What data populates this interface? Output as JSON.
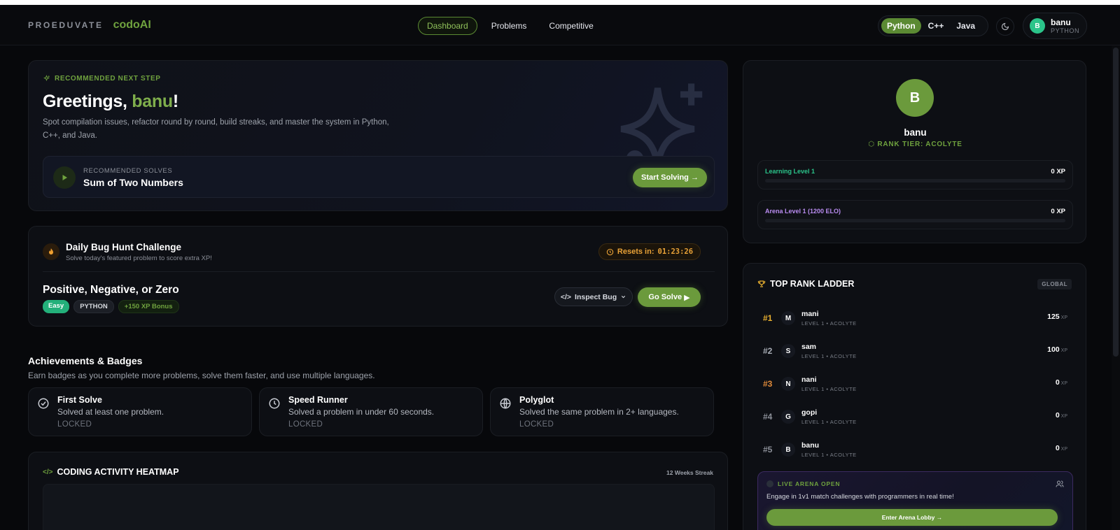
{
  "header": {
    "brand_main": "PROEDUVATE",
    "brand_sub": "codoAI",
    "nav": [
      {
        "label": "Dashboard",
        "active": true
      },
      {
        "label": "Problems",
        "active": false
      },
      {
        "label": "Competitive",
        "active": false
      }
    ],
    "languages": [
      {
        "label": "Python",
        "active": true
      },
      {
        "label": "C++",
        "active": false
      },
      {
        "label": "Java",
        "active": false
      }
    ],
    "theme_icon": "moon-icon",
    "user": {
      "initial": "B",
      "name": "banu",
      "language": "PYTHON"
    }
  },
  "hero": {
    "kicker": "RECOMMENDED NEXT STEP",
    "greeting_prefix": "Greetings, ",
    "greeting_name": "banu",
    "greeting_suffix": "!",
    "description": "Spot compilation issues, refactor round by round, build streaks, and master the system in Python, C++, and Java.",
    "recommended_kicker": "RECOMMENDED SOLVES",
    "recommended_title": "Sum of Two Numbers",
    "start_label": "Start Solving"
  },
  "daily": {
    "title": "Daily Bug Hunt Challenge",
    "subtitle": "Solve today's featured problem to score extra XP!",
    "reset_label": "Resets in:",
    "reset_time": "01:23:26",
    "problem_title": "Positive, Negative, or Zero",
    "tags": {
      "difficulty": "Easy",
      "language": "PYTHON",
      "bonus": "+150 XP Bonus"
    },
    "inspect_label": "Inspect Bug",
    "go_label": "Go Solve"
  },
  "achievements": {
    "title": "Achievements & Badges",
    "subtitle": "Earn badges as you complete more problems, solve them faster, and use multiple languages.",
    "badges": [
      {
        "name": "First Solve",
        "desc": "Solved at least one problem.",
        "state": "LOCKED",
        "icon": "check-circle-icon"
      },
      {
        "name": "Speed Runner",
        "desc": "Solved a problem in under 60 seconds.",
        "state": "LOCKED",
        "icon": "clock-icon"
      },
      {
        "name": "Polyglot",
        "desc": "Solved the same problem in 2+ languages.",
        "state": "LOCKED",
        "icon": "globe-icon"
      }
    ]
  },
  "heatmap": {
    "title": "CODING ACTIVITY HEATMAP",
    "streak": "12 Weeks Streak"
  },
  "profile": {
    "initial": "B",
    "name": "banu",
    "tier": "RANK TIER: ACOLYTE",
    "learning": {
      "label": "Learning Level 1",
      "xp": "0 XP",
      "progress": 0,
      "color": "#2bc48a"
    },
    "arena": {
      "label": "Arena Level 1 (1200 ELO)",
      "xp": "0 XP",
      "progress": 0,
      "color": "#b98cf0"
    }
  },
  "ladder": {
    "title": "TOP RANK LADDER",
    "scope": "GLOBAL",
    "xp_unit": "XP",
    "rows": [
      {
        "rank": "#1",
        "initial": "M",
        "name": "mani",
        "meta": "LEVEL 1 • ACOLYTE",
        "xp": "125",
        "rank_color": "#e9b030"
      },
      {
        "rank": "#2",
        "initial": "S",
        "name": "sam",
        "meta": "LEVEL 1 • ACOLYTE",
        "xp": "100",
        "rank_color": "#a8adb6"
      },
      {
        "rank": "#3",
        "initial": "N",
        "name": "nani",
        "meta": "LEVEL 1 • ACOLYTE",
        "xp": "0",
        "rank_color": "#e08a3a"
      },
      {
        "rank": "#4",
        "initial": "G",
        "name": "gopi",
        "meta": "LEVEL 1 • ACOLYTE",
        "xp": "0",
        "rank_color": "#8b8f98"
      },
      {
        "rank": "#5",
        "initial": "B",
        "name": "banu",
        "meta": "LEVEL 1 • ACOLYTE",
        "xp": "0",
        "rank_color": "#8b8f98"
      }
    ],
    "arena": {
      "kicker": "LIVE ARENA OPEN",
      "desc": "Engage in 1v1 match challenges with programmers in real time!",
      "button": "Enter Arena Lobby"
    }
  }
}
